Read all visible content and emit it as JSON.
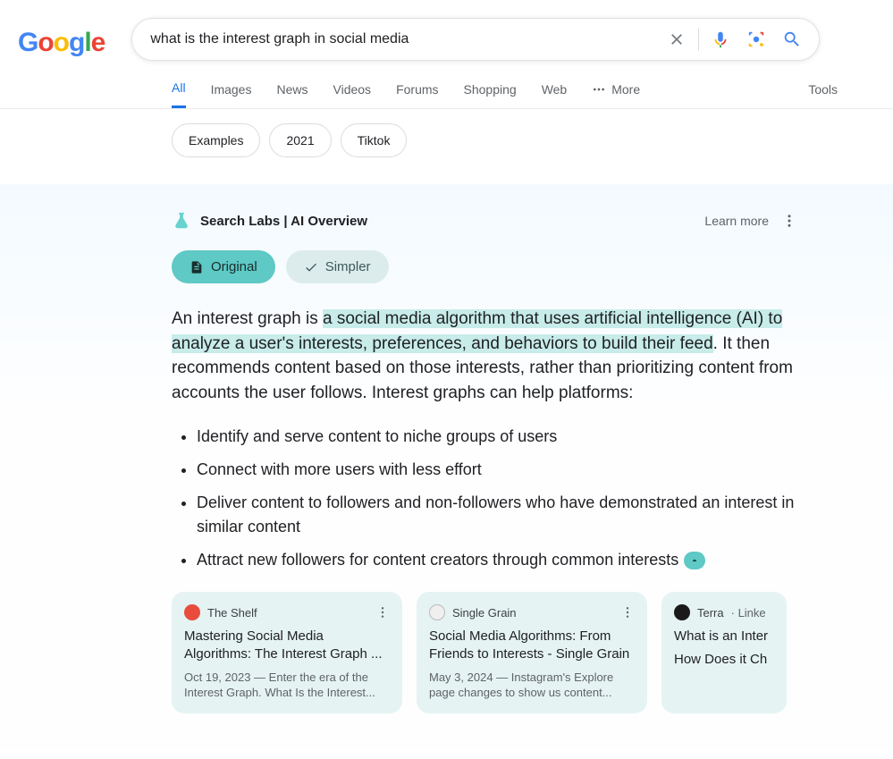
{
  "logo": {
    "g1": "G",
    "o1": "o",
    "o2": "o",
    "g2": "g",
    "l": "l",
    "e": "e"
  },
  "search": {
    "query": "what is the interest graph in social media"
  },
  "tabs": {
    "all": "All",
    "images": "Images",
    "news": "News",
    "videos": "Videos",
    "forums": "Forums",
    "shopping": "Shopping",
    "web": "Web",
    "more": "More",
    "tools": "Tools"
  },
  "chips": {
    "examples": "Examples",
    "y2021": "2021",
    "tiktok": "Tiktok"
  },
  "ai": {
    "label": "Search Labs | AI Overview",
    "learn": "Learn more",
    "mode_original": "Original",
    "mode_simpler": "Simpler",
    "text_prefix": "An interest graph is ",
    "text_highlight": "a social media algorithm that uses artificial intelligence (AI) to analyze a user's interests, preferences, and behaviors to build their feed",
    "text_suffix": ". It then recommends content based on those interests, rather than prioritizing content from accounts the user follows. Interest graphs can help platforms:",
    "bullets": [
      "Identify and serve content to niche groups of users",
      "Connect with more users with less effort",
      "Deliver content to followers and non-followers who have demonstrated an interest in similar content",
      "Attract new followers for content creators through common interests"
    ]
  },
  "cards": [
    {
      "source": "The Shelf",
      "title": "Mastering Social Media Algorithms: The Interest Graph ...",
      "snippet": "Oct 19, 2023 — Enter the era of the Interest Graph. What Is the Interest...",
      "favcolor": "#e84c3d"
    },
    {
      "source": "Single Grain",
      "title": "Social Media Algorithms: From Friends to Interests - Single Grain",
      "snippet": "May 3, 2024 — Instagram's Explore page changes to show us content...",
      "favcolor": "#9e9e9e"
    },
    {
      "source": "Terra",
      "source_extra": " ·  Linke",
      "title": "What is an Inter",
      "title2": "How Does it Ch",
      "favcolor": "#1a1a1a"
    }
  ]
}
